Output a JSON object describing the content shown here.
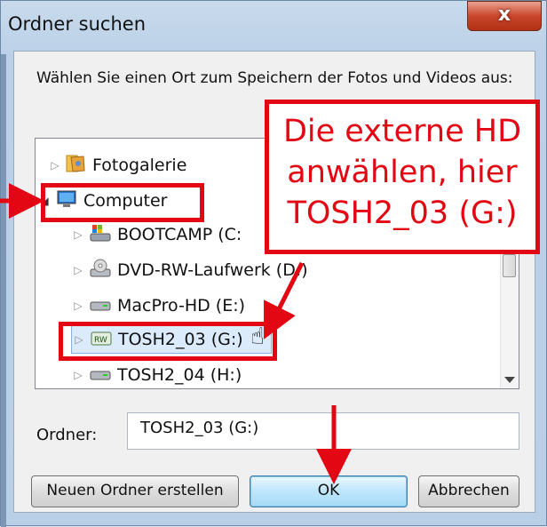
{
  "dialog": {
    "title": "Ordner suchen",
    "close_label": "x",
    "description": "Wählen Sie einen Ort zum Speichern der Fotos und Videos aus:"
  },
  "tree": {
    "items": [
      {
        "label": "Fotogalerie",
        "icon": "photo-gallery-icon"
      },
      {
        "label": "Computer",
        "icon": "computer-icon"
      },
      {
        "label": "BOOTCAMP (C:",
        "icon": "windows-drive-icon"
      },
      {
        "label": "DVD-RW-Laufwerk (D:)",
        "icon": "dvd-drive-icon"
      },
      {
        "label": "MacPro-HD (E:)",
        "icon": "hard-drive-icon"
      },
      {
        "label": "TOSH2_03 (G:)",
        "icon": "removable-drive-icon"
      },
      {
        "label": "TOSH2_04 (H:)",
        "icon": "hard-drive-icon"
      }
    ],
    "selected": "TOSH2_03 (G:)"
  },
  "folder": {
    "label": "Ordner:",
    "value": "TOSH2_03 (G:)"
  },
  "buttons": {
    "new_folder": "Neuen Ordner erstellen",
    "ok": "OK",
    "cancel": "Abbrechen"
  },
  "annotation": {
    "callout_text": "Die externe HD anwählen, hier TOSH2_03 (G:)",
    "color": "#e30613"
  }
}
